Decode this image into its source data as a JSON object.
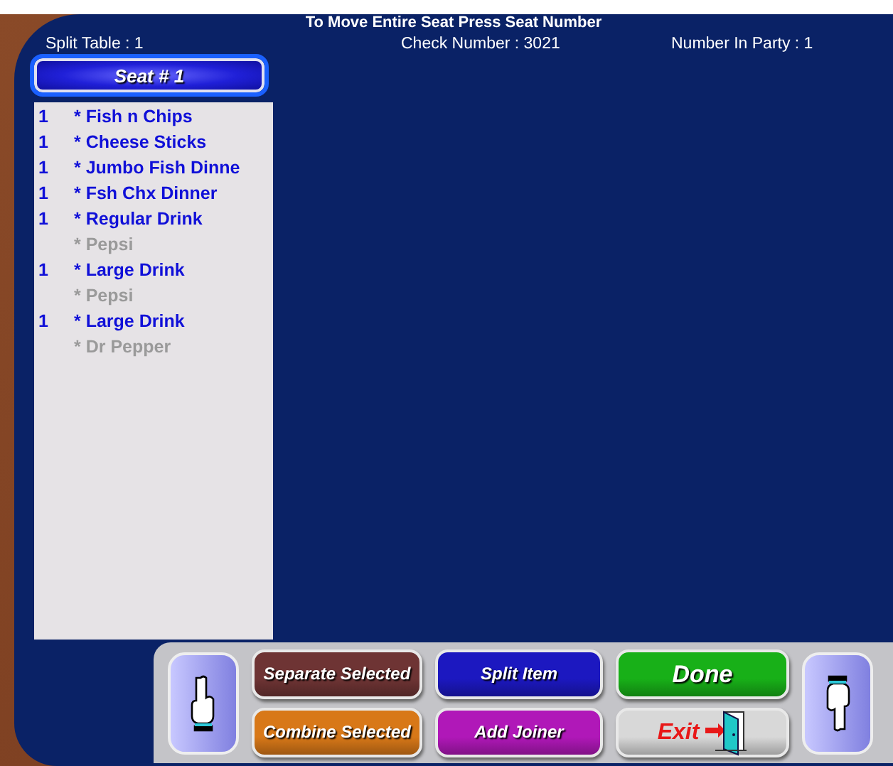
{
  "header": {
    "title": "To Move Entire Seat Press Seat Number",
    "split_table": "Split Table : 1",
    "check_number": "Check Number : 3021",
    "party": "Number In Party : 1"
  },
  "seat": {
    "label": "Seat # 1"
  },
  "items": [
    {
      "kind": "item",
      "qty": "1",
      "name": "* Fish n Chips"
    },
    {
      "kind": "item",
      "qty": "1",
      "name": "* Cheese Sticks"
    },
    {
      "kind": "item",
      "qty": "1",
      "name": "* Jumbo Fish Dinne"
    },
    {
      "kind": "item",
      "qty": "1",
      "name": "* Fsh Chx Dinner"
    },
    {
      "kind": "item",
      "qty": "1",
      "name": "* Regular Drink"
    },
    {
      "kind": "modifier",
      "name": "* Pepsi"
    },
    {
      "kind": "item",
      "qty": "1",
      "name": "* Large Drink"
    },
    {
      "kind": "modifier",
      "name": "* Pepsi"
    },
    {
      "kind": "item",
      "qty": "1",
      "name": "* Large Drink"
    },
    {
      "kind": "modifier",
      "name": "* Dr Pepper"
    }
  ],
  "buttons": [
    {
      "label": "Separate Selected",
      "color": "#6e3434"
    },
    {
      "label": "Split Item",
      "color": "#1c18c0"
    },
    {
      "label": "Done",
      "color": "#18b018"
    },
    {
      "label": "Combine Selected",
      "color": "#d87818"
    },
    {
      "label": "Add Joiner",
      "color": "#b018b8"
    },
    {
      "label": "Exit",
      "color": "#d8d8d8"
    }
  ]
}
